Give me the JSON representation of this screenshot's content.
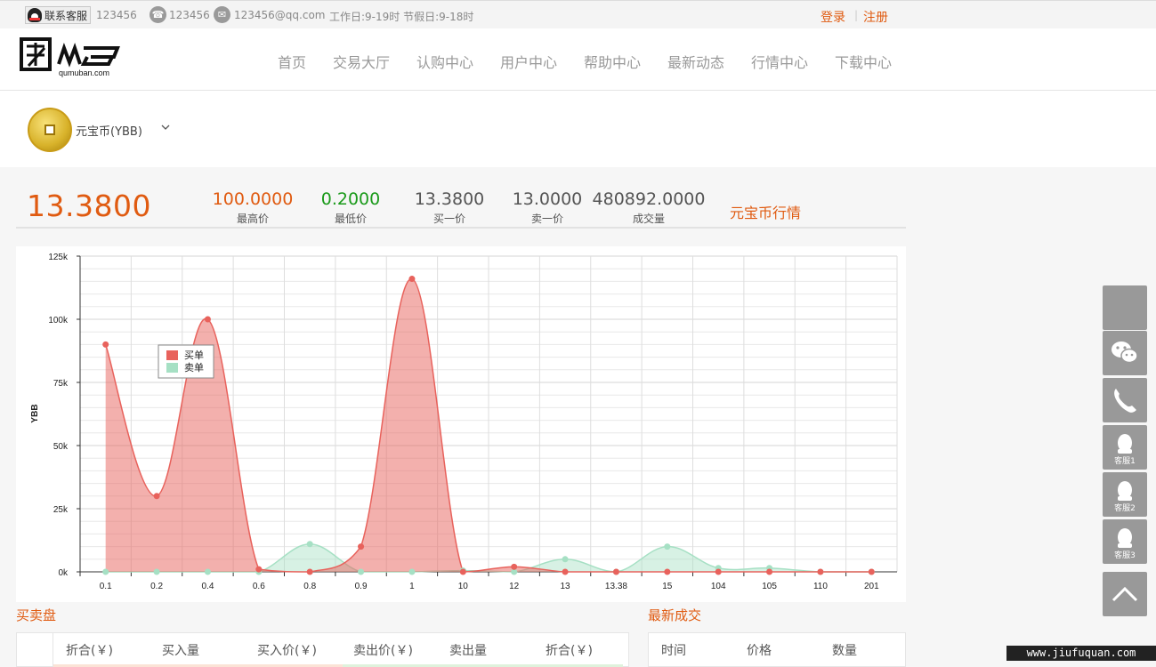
{
  "topbar": {
    "qq_label": "联系客服",
    "qq_number": "123456",
    "phone": "123456",
    "email": "123456@qq.com",
    "hours": "工作日:9-19时 节假日:9-18时",
    "login": "登录",
    "separator": "|",
    "register": "注册"
  },
  "header": {
    "logo_text": "qumuban.com",
    "nav": [
      "首页",
      "交易大厅",
      "认购中心",
      "用户中心",
      "帮助中心",
      "最新动态",
      "行情中心",
      "下载中心"
    ]
  },
  "coin": {
    "name": "元宝币(YBB)"
  },
  "stats": {
    "current_price": "13.3800",
    "items": [
      {
        "value": "100.0000",
        "label": "最高价",
        "color": "#e05b11"
      },
      {
        "value": "0.2000",
        "label": "最低价",
        "color": "#1a9a1a"
      },
      {
        "value": "13.3800",
        "label": "买一价",
        "color": "#555555"
      },
      {
        "value": "13.0000",
        "label": "卖一价",
        "color": "#555555"
      },
      {
        "value": "480892.0000",
        "label": "成交量",
        "color": "#555555"
      }
    ],
    "tab": "元宝币行情"
  },
  "chart_data": {
    "type": "area",
    "title": "",
    "xlabel": "",
    "ylabel": "YBB",
    "categories": [
      "0.1",
      "0.2",
      "0.4",
      "0.6",
      "0.8",
      "0.9",
      "1",
      "10",
      "12",
      "13",
      "13.38",
      "15",
      "104",
      "105",
      "110",
      "201"
    ],
    "ylim": [
      0,
      125000
    ],
    "yticks": [
      "0k",
      "25k",
      "50k",
      "75k",
      "100k",
      "125k"
    ],
    "grid": true,
    "legend": "top-left",
    "series": [
      {
        "name": "买单",
        "color": "#e8625c",
        "values": [
          90000,
          30000,
          100000,
          1000,
          0,
          10000,
          116000,
          0,
          2000,
          0,
          0,
          0,
          0,
          0,
          0,
          0
        ]
      },
      {
        "name": "卖单",
        "color": "#a6e0c4",
        "values": [
          0,
          0,
          0,
          0,
          11000,
          0,
          0,
          500,
          0,
          5000,
          0,
          10000,
          1500,
          1500,
          0,
          0
        ]
      }
    ]
  },
  "orderbook": {
    "title": "买卖盘",
    "headers": [
      "折合(￥)",
      "买入量",
      "买入价(￥)",
      "卖出价(￥)",
      "卖出量",
      "折合(￥)"
    ]
  },
  "trades": {
    "title": "最新成交",
    "headers": [
      "时间",
      "价格",
      "数量"
    ]
  },
  "float": {
    "kf1": "客服1",
    "kf2": "客服2",
    "kf3": "客服3"
  },
  "watermark": "www.jiufuquan.com"
}
